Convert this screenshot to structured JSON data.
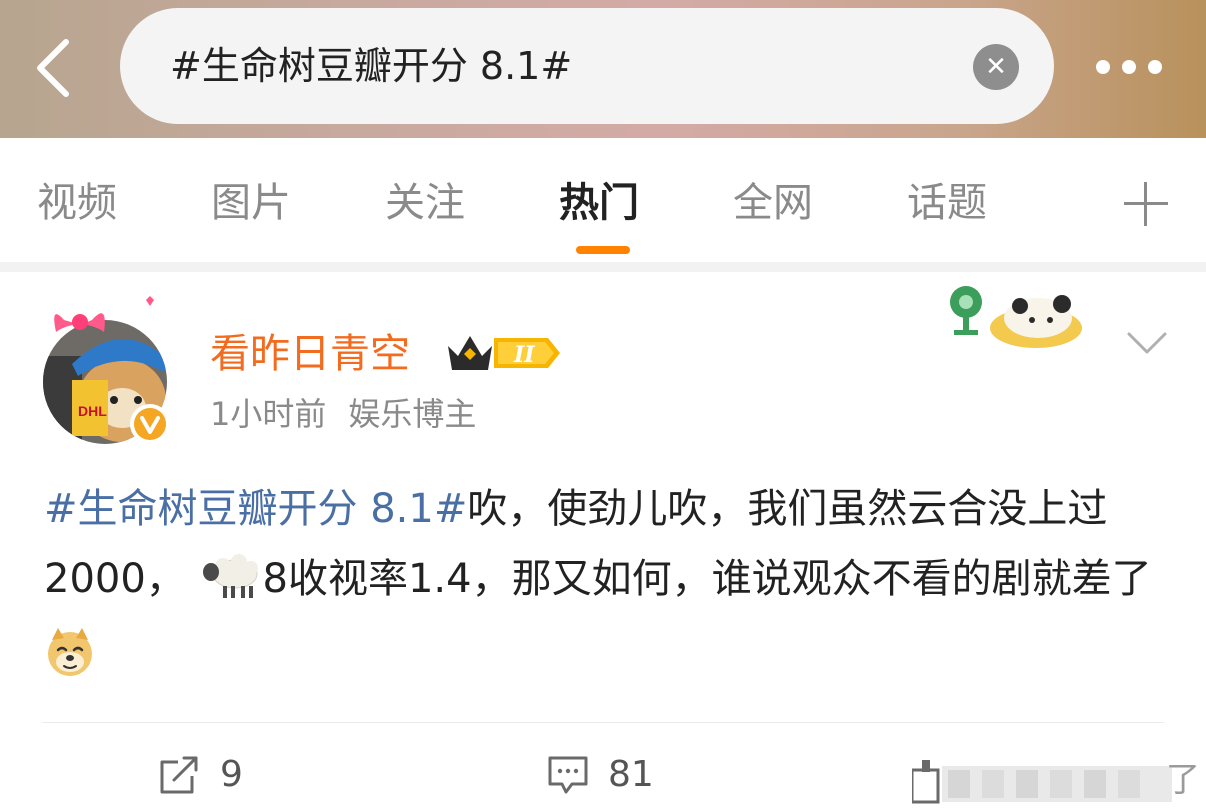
{
  "header": {
    "search_query": "#生命树豆瓣开分 8.1#",
    "icons": [
      "back-arrow-icon",
      "clear-icon",
      "more-icon"
    ]
  },
  "tabs": [
    {
      "label": "视频",
      "active": false
    },
    {
      "label": "图片",
      "active": false
    },
    {
      "label": "关注",
      "active": false
    },
    {
      "label": "热门",
      "active": true
    },
    {
      "label": "全网",
      "active": false
    },
    {
      "label": "话题",
      "active": false
    }
  ],
  "post": {
    "username": "看昨日青空",
    "badge_text": "II",
    "time": "1小时前",
    "user_tag": "娱乐博主",
    "hashtag": "#生命树豆瓣开分 8.1#",
    "text_part1": "吹，使劲儿吹，我们虽然云合没上过2000，",
    "text_part2": "8收视率1.4，那又如何，谁说观众不看的剧就差了",
    "emojis": [
      "sheep-emoji",
      "doge-emoji"
    ]
  },
  "actions": {
    "repost_count": "9",
    "comment_count": "81",
    "partial_label": "了"
  },
  "colors": {
    "accent": "#ff8200",
    "username": "#f36b1f",
    "hashtag": "#4a6fa5",
    "verified": "#f5a623"
  }
}
